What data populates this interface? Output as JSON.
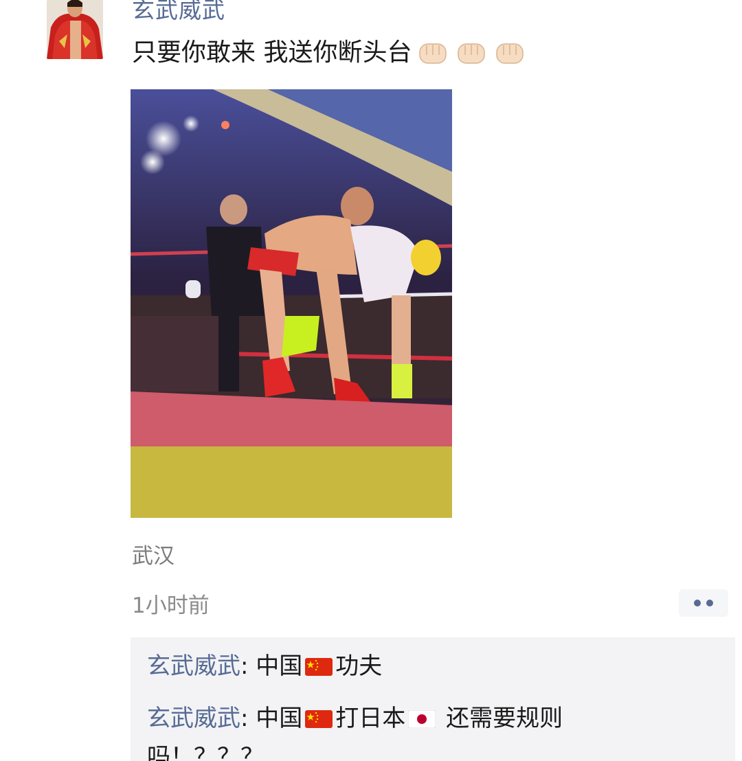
{
  "post": {
    "username": "玄武威武",
    "text": "只要你敢来 我送你断头台",
    "emoji": [
      "fist-icon",
      "fist-icon",
      "fist-icon"
    ],
    "location": "武汉",
    "time": "1小时前"
  },
  "comments": [
    {
      "name": "玄武威武",
      "sep": ": ",
      "text_a": "中国",
      "flag_a": "china-flag-icon",
      "text_b": "功夫"
    },
    {
      "name": "玄武威武",
      "sep": ": ",
      "text_a": "中国",
      "flag_a": "china-flag-icon",
      "text_b": "打日本",
      "flag_b": "japan-flag-icon",
      "text_c": " 还需要规则",
      "text_d": "吗！？？？"
    }
  ],
  "colors": {
    "name_link": "#576b95",
    "comment_bg": "#f3f3f5"
  }
}
